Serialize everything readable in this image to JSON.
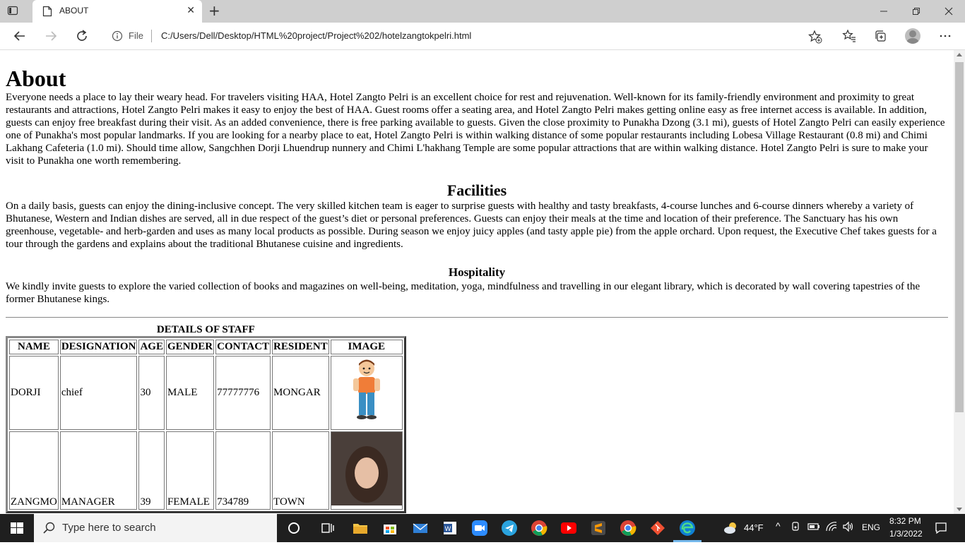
{
  "browser": {
    "tab_title": "ABOUT",
    "file_label": "File",
    "url": "C:/Users/Dell/Desktop/HTML%20project/Project%202/hotelzangtokpelri.html"
  },
  "page": {
    "title": "About",
    "intro": "Everyone needs a place to lay their weary head. For travelers visiting HAA, Hotel Zangto Pelri is an excellent choice for rest and rejuvenation. Well-known for its family-friendly environment and proximity to great restaurants and attractions, Hotel Zangto Pelri makes it easy to enjoy the best of HAA. Guest rooms offer a seating area, and Hotel Zangto Pelri makes getting online easy as free internet access is available. In addition, guests can enjoy free breakfast during their visit. As an added convenience, there is free parking available to guests. Given the close proximity to Punakha Dzong (3.1 mi), guests of Hotel Zangto Pelri can easily experience one of Punakha's most popular landmarks. If you are looking for a nearby place to eat, Hotel Zangto Pelri is within walking distance of some popular restaurants including Lobesa Village Restaurant (0.8 mi) and Chimi Lakhang Cafeteria (1.0 mi). Should time allow, Sangchhen Dorji Lhuendrup nunnery and Chimi L'hakhang Temple are some popular attractions that are within walking distance. Hotel Zangto Pelri is sure to make your visit to Punakha one worth remembering.",
    "facilities_heading": "Facilities",
    "facilities_text": "On a daily basis, guests can enjoy the dining-inclusive concept. The very skilled kitchen team is eager to surprise guests with healthy and tasty breakfasts, 4-course lunches and 6-course dinners whereby a variety of Bhutanese, Western and Indian dishes are served, all in due respect of the guest’s diet or personal preferences. Guests can enjoy their meals at the time and location of their preference. The Sanctuary has his own greenhouse, vegetable- and herb-garden and uses as many local products as possible. During season we enjoy juicy apples (and tasty apple pie) from the apple orchard. Upon request, the Executive Chef takes guests for a tour through the gardens and explains about the traditional Bhutanese cuisine and ingredients.",
    "hospitality_heading": "Hospitality",
    "hospitality_text": "We kindly invite guests to explore the varied collection of books and magazines on well-being, meditation, yoga, mindfulness and travelling in our elegant library, which is decorated by wall covering tapestries of the former Bhutanese kings."
  },
  "staff_table": {
    "caption": "DETAILS OF STAFF",
    "headers": {
      "name": "NAME",
      "designation": "DESIGNATION",
      "age": "AGE",
      "gender": "GENDER",
      "contact": "CONTACT",
      "resident": "RESIDENT",
      "image": "IMAGE"
    },
    "rows": [
      {
        "name": "DORJI",
        "designation": "chief",
        "age": "30",
        "gender": "MALE",
        "contact": "77777776",
        "resident": "MONGAR"
      },
      {
        "name": "ZANGMO",
        "designation": "MANAGER",
        "age": "39",
        "gender": "FEMALE",
        "contact": "734789",
        "resident": "TOWN"
      }
    ]
  },
  "taskbar": {
    "search_placeholder": "Type here to search",
    "weather": "44°F",
    "language": "ENG",
    "time": "8:32 PM",
    "date": "1/3/2022"
  }
}
